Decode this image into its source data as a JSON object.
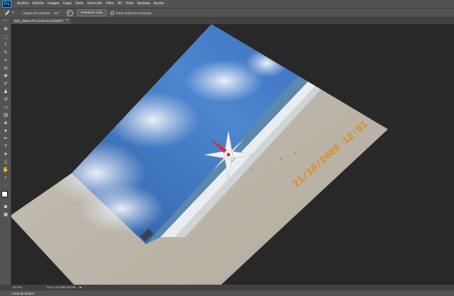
{
  "app": {
    "logo": "Ps"
  },
  "menu": [
    "Archivo",
    "Edición",
    "Imagen",
    "Capa",
    "Texto",
    "Selección",
    "Filtro",
    "3D",
    "Vista",
    "Ventana",
    "Ayuda"
  ],
  "options": {
    "tool_icon": "rotate-view-icon",
    "rotation_label": "Ángulo de rotación:",
    "rotation_value": "-41°",
    "reset_button": "Restaurar vista",
    "rotate_all_label": "Rotar todas las ventanas"
  },
  "document": {
    "tab_title": "IMG_2925.JPG al 56,3% (RGB/8*)",
    "date_stamp": "21/10/2009 12:51"
  },
  "status": {
    "zoom": "56,25%",
    "doc_info": "Doc: 5,49 MB/5,49 MB"
  },
  "timeline": {
    "tab_label": "Línea de tiempo"
  },
  "colors": {
    "accent_blue": "#31a8ff",
    "compass_red": "#e0282e",
    "date_orange": "#e08a1c"
  }
}
